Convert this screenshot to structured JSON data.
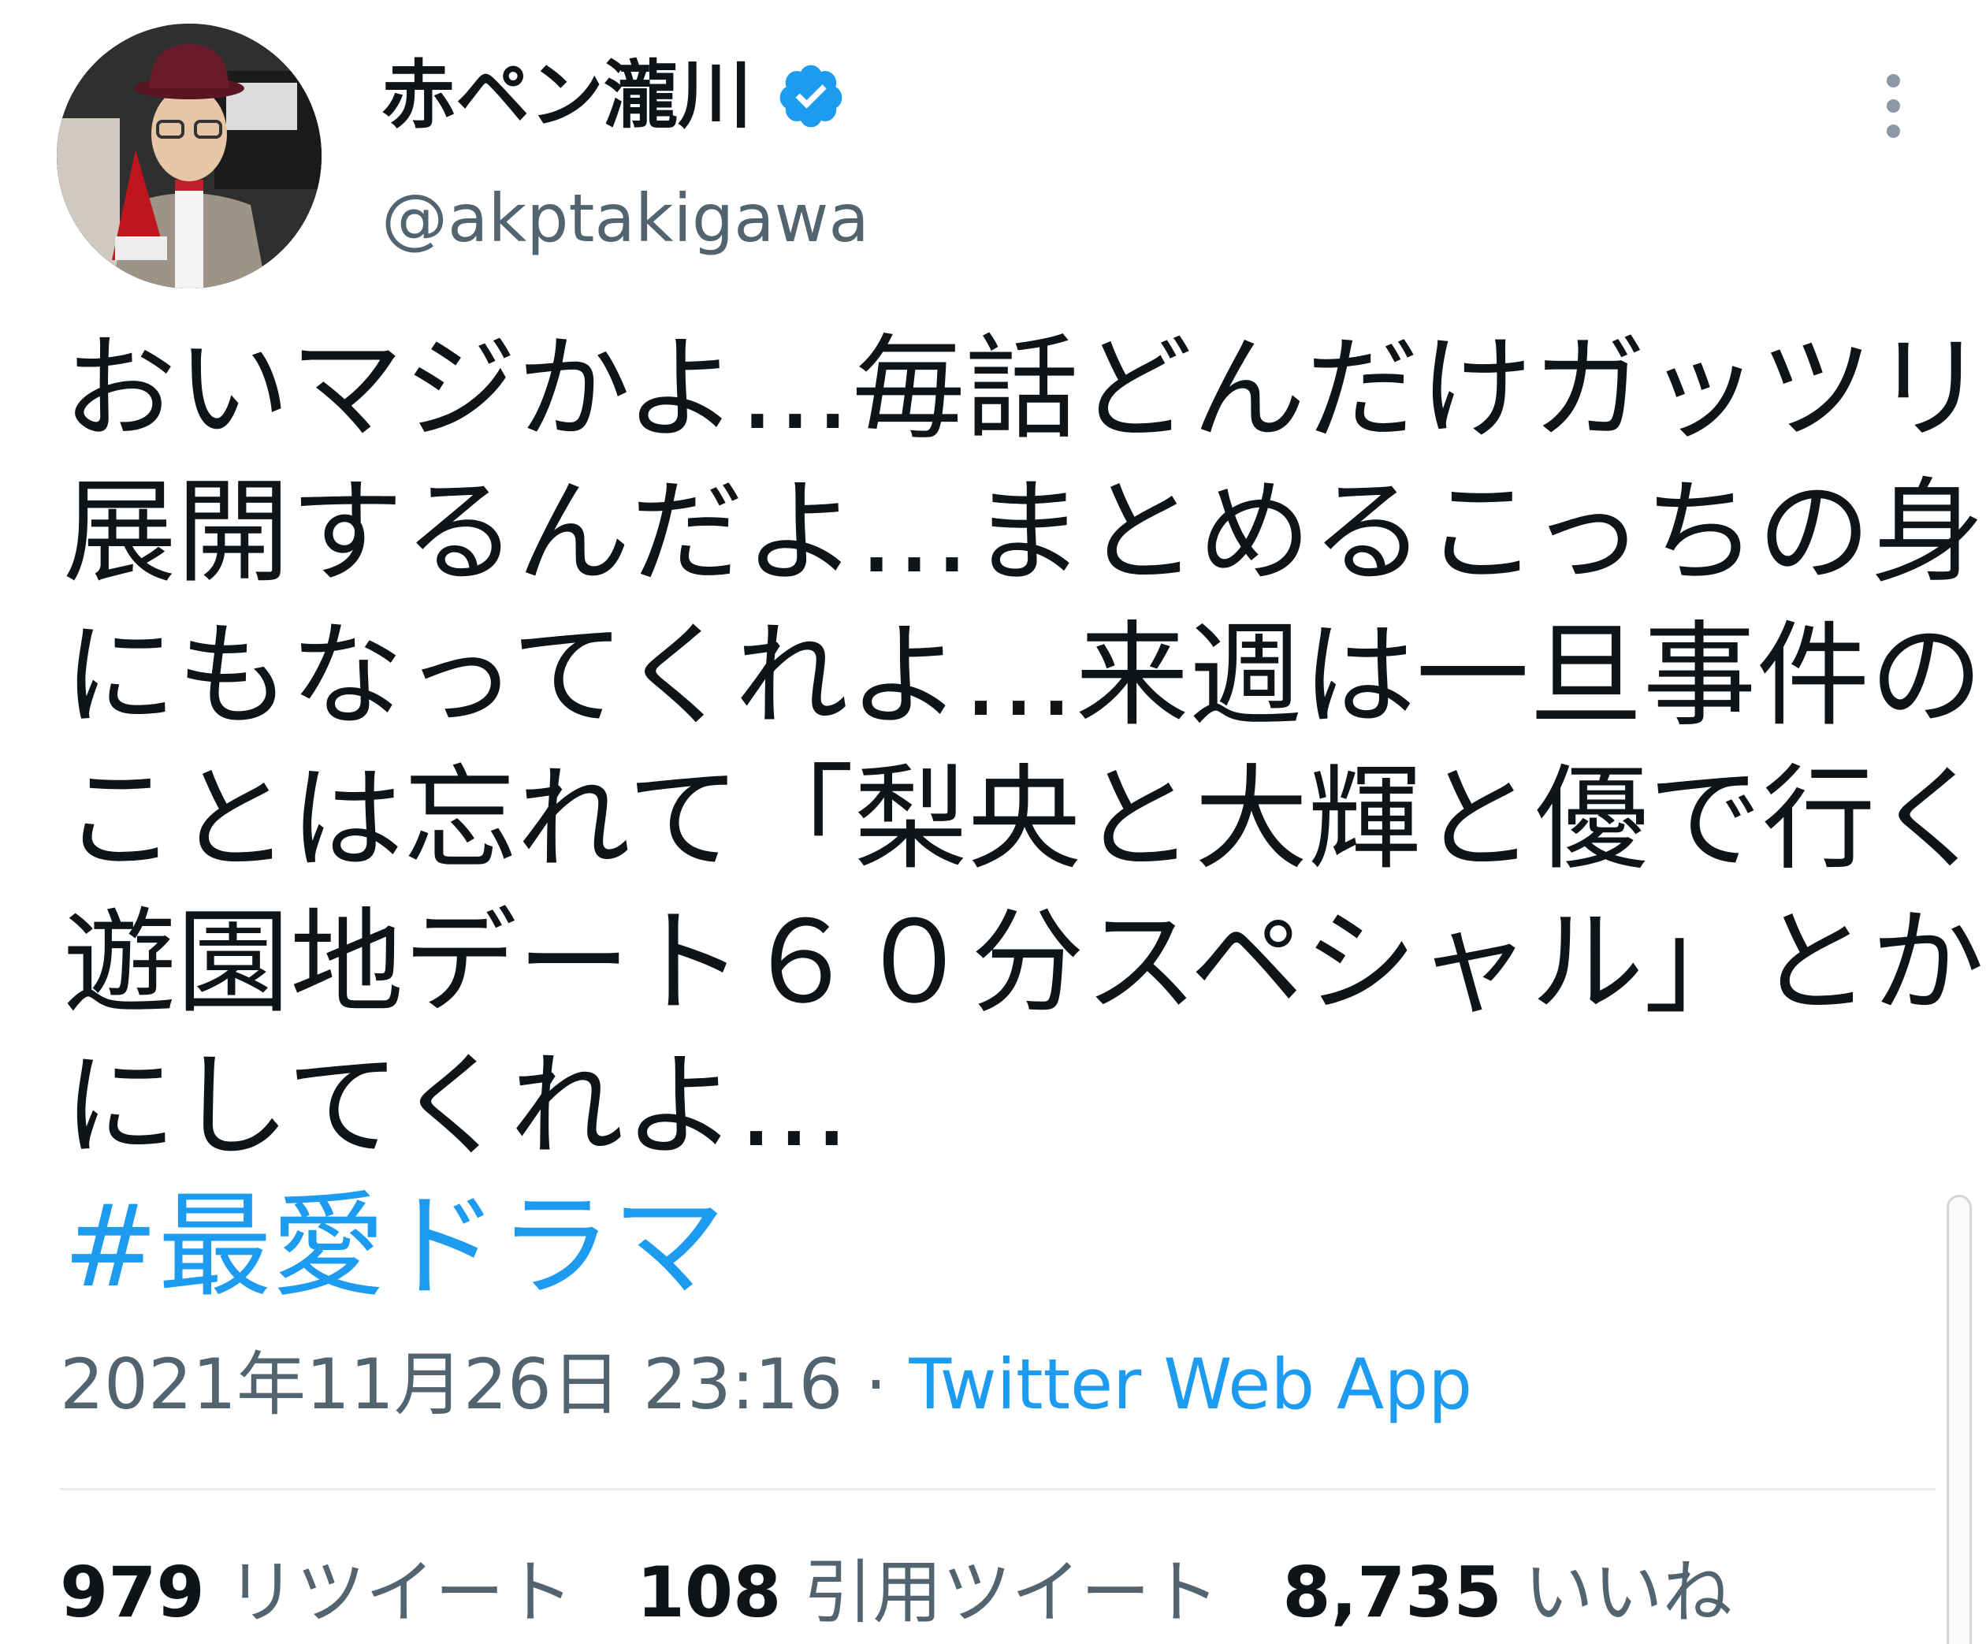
{
  "author": {
    "display_name": "赤ペン瀧川",
    "handle": "@akptakigawa",
    "verified": true
  },
  "tweet": {
    "lines": [
      "おいマジかよ…毎話どんだけガッツリ",
      "展開するんだよ…まとめるこっちの身",
      "にもなってくれよ…来週は一旦事件の",
      "ことは忘れて「梨央と大輝と優で行く",
      "遊園地デート６０分スペシャル」とか",
      "にしてくれよ…"
    ],
    "hashtag": "#最愛ドラマ"
  },
  "meta": {
    "timestamp": "2021年11月26日 23:16",
    "separator": " · ",
    "source": "Twitter Web App"
  },
  "stats": {
    "retweets_count": "979",
    "retweets_label": "リツイート",
    "quotes_count": "108",
    "quotes_label": "引用ツイート",
    "likes_count": "8,735",
    "likes_label": "いいね"
  },
  "icons": {
    "verified": "verified-badge-icon",
    "more": "more-options-icon"
  },
  "colors": {
    "accent": "#1d9bf0",
    "text": "#0f1419",
    "secondary": "#536471"
  }
}
